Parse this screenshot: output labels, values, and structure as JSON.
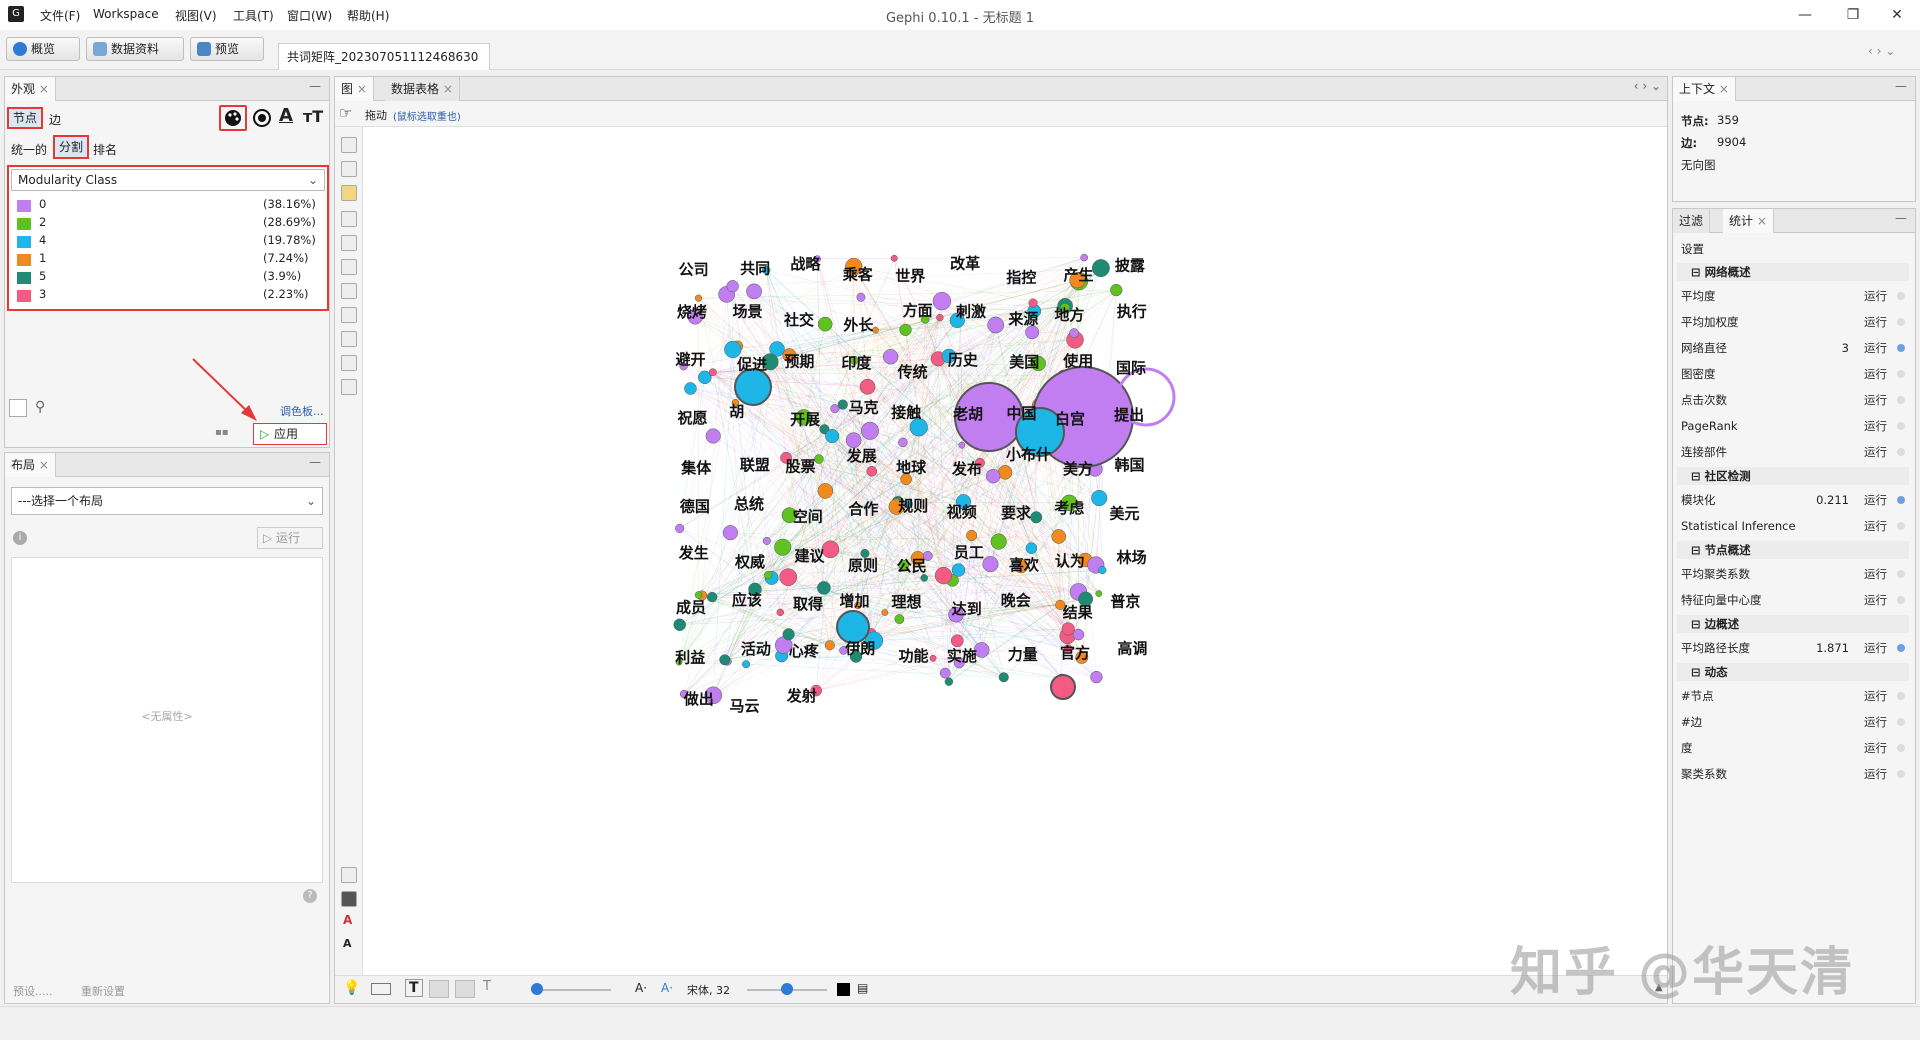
{
  "titlebar": {
    "title": "Gephi 0.10.1 - 无标题 1",
    "menus": [
      "文件(F)",
      "Workspace",
      "视图(V)",
      "工具(T)",
      "窗口(W)",
      "帮助(H)"
    ],
    "controls": [
      "—",
      "❐",
      "✕"
    ]
  },
  "toolbar": {
    "overview": "概览",
    "data_lab": "数据资料",
    "preview": "预览",
    "doc_tab": "共词矩阵_202307051112468630"
  },
  "appearance": {
    "tab": "外观",
    "node_tab": "节点",
    "edge_tab": "边",
    "unique": "统一的",
    "partition": "分割",
    "ranking": "排名",
    "attribute": "Modularity Class",
    "classes": [
      {
        "label": "0",
        "pct": "(38.16%)",
        "color": "#c07ef0"
      },
      {
        "label": "2",
        "pct": "(28.69%)",
        "color": "#5fc221"
      },
      {
        "label": "4",
        "pct": "(19.78%)",
        "color": "#1eb6e6"
      },
      {
        "label": "1",
        "pct": "(7.24%)",
        "color": "#f08a1e"
      },
      {
        "label": "5",
        "pct": "(3.9%)",
        "color": "#1f8b74"
      },
      {
        "label": "3",
        "pct": "(2.23%)",
        "color": "#f25c84"
      }
    ],
    "palette": "调色板...",
    "apply": "应用"
  },
  "layout": {
    "tab": "布局",
    "select": "---选择一个布局",
    "run": "运行",
    "no_props": "<无属性>",
    "presets": "预设.....",
    "reset": "重新设置"
  },
  "graph": {
    "tab_graph": "图",
    "tab_table": "数据表格",
    "drag": "拖动",
    "drag_hint": "(鼠标选取重也)",
    "font_label": "宋体, 32",
    "labels": [
      {
        "t": "公司"
      },
      {
        "t": "共同"
      },
      {
        "t": "战略"
      },
      {
        "t": "乘客"
      },
      {
        "t": "世界"
      },
      {
        "t": "改革"
      },
      {
        "t": "指控"
      },
      {
        "t": "产生"
      },
      {
        "t": "披露"
      },
      {
        "t": "烧烤"
      },
      {
        "t": "场景"
      },
      {
        "t": "社交"
      },
      {
        "t": "外长"
      },
      {
        "t": "方面"
      },
      {
        "t": "刺激"
      },
      {
        "t": "来源"
      },
      {
        "t": "地方"
      },
      {
        "t": "执行"
      },
      {
        "t": "避开"
      },
      {
        "t": "促进"
      },
      {
        "t": "预期"
      },
      {
        "t": "印度"
      },
      {
        "t": "传统"
      },
      {
        "t": "历史"
      },
      {
        "t": "美国"
      },
      {
        "t": "使用"
      },
      {
        "t": "国际"
      },
      {
        "t": "祝愿"
      },
      {
        "t": "胡"
      },
      {
        "t": "开展"
      },
      {
        "t": "马克"
      },
      {
        "t": "接触"
      },
      {
        "t": "老胡"
      },
      {
        "t": "中国"
      },
      {
        "t": "白宫"
      },
      {
        "t": "提出"
      },
      {
        "t": "集体"
      },
      {
        "t": "联盟"
      },
      {
        "t": "股票"
      },
      {
        "t": "发展"
      },
      {
        "t": "地球"
      },
      {
        "t": "发布"
      },
      {
        "t": "小布什"
      },
      {
        "t": "美方"
      },
      {
        "t": "韩国"
      },
      {
        "t": "德国"
      },
      {
        "t": "总统"
      },
      {
        "t": "空间"
      },
      {
        "t": "合作"
      },
      {
        "t": "规则"
      },
      {
        "t": "视频"
      },
      {
        "t": "要求"
      },
      {
        "t": "考虑"
      },
      {
        "t": "美元"
      },
      {
        "t": "发生"
      },
      {
        "t": "权威"
      },
      {
        "t": "建议"
      },
      {
        "t": "原则"
      },
      {
        "t": "公民"
      },
      {
        "t": "员工"
      },
      {
        "t": "喜欢"
      },
      {
        "t": "认为"
      },
      {
        "t": "林场"
      },
      {
        "t": "成员"
      },
      {
        "t": "应该"
      },
      {
        "t": "取得"
      },
      {
        "t": "增加"
      },
      {
        "t": "理想"
      },
      {
        "t": "达到"
      },
      {
        "t": "晚会"
      },
      {
        "t": "结果"
      },
      {
        "t": "普京"
      },
      {
        "t": "利益"
      },
      {
        "t": "活动"
      },
      {
        "t": "心疼"
      },
      {
        "t": "伊朗"
      },
      {
        "t": "功能"
      },
      {
        "t": "实施"
      },
      {
        "t": "力量"
      },
      {
        "t": "官方"
      },
      {
        "t": "高调"
      },
      {
        "t": "做出"
      },
      {
        "t": "马云"
      },
      {
        "t": "发射"
      }
    ]
  },
  "context": {
    "tab": "上下文",
    "nodes_label": "节点:",
    "nodes_val": "359",
    "edges_label": "边:",
    "edges_val": "9904",
    "graph_type": "无向图"
  },
  "stats": {
    "tab_filter": "过滤",
    "tab_stats": "统计",
    "settings": "设置",
    "run": "运行",
    "sections": [
      {
        "title": "网络概述",
        "items": [
          {
            "name": "平均度",
            "val": ""
          },
          {
            "name": "平均加权度",
            "val": ""
          },
          {
            "name": "网络直径",
            "val": "3"
          },
          {
            "name": "图密度",
            "val": ""
          },
          {
            "name": "点击次数",
            "val": ""
          },
          {
            "name": "PageRank",
            "val": ""
          },
          {
            "name": "连接部件",
            "val": ""
          }
        ]
      },
      {
        "title": "社区检测",
        "items": [
          {
            "name": "模块化",
            "val": "0.211"
          },
          {
            "name": "Statistical Inference",
            "val": ""
          }
        ]
      },
      {
        "title": "节点概述",
        "items": [
          {
            "name": "平均聚类系数",
            "val": ""
          },
          {
            "name": "特征向量中心度",
            "val": ""
          }
        ]
      },
      {
        "title": "边概述",
        "items": [
          {
            "name": "平均路径长度",
            "val": "1.871"
          }
        ]
      },
      {
        "title": "动态",
        "items": [
          {
            "name": "#节点",
            "val": ""
          },
          {
            "name": "#边",
            "val": ""
          },
          {
            "name": "度",
            "val": ""
          },
          {
            "name": "聚类系数",
            "val": ""
          }
        ]
      }
    ]
  },
  "watermark": "知乎 @华天清"
}
